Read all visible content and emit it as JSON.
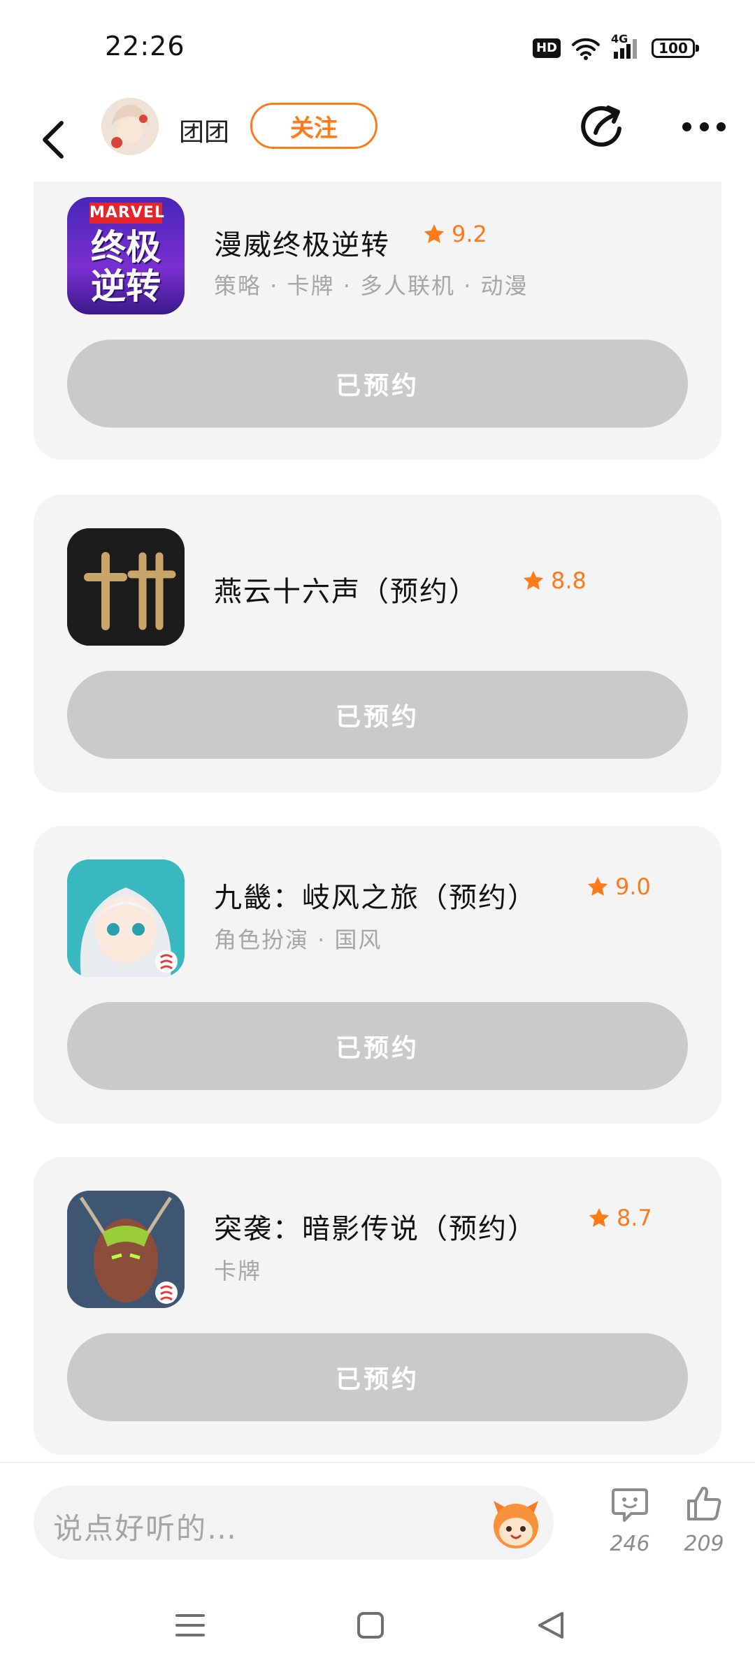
{
  "status_bar": {
    "time": "22:26",
    "hd": "HD",
    "network": "4G",
    "battery": "100"
  },
  "header": {
    "username": "团团",
    "follow_label": "关注"
  },
  "games": [
    {
      "title": "漫威终极逆转",
      "rating": "9.2",
      "tags": "策略 · 卡牌 · 多人联机 · 动漫",
      "button": "已预约",
      "icon": "marvel-snap-icon",
      "icon_text": "MARVEL",
      "icon_text2": "终极逆转"
    },
    {
      "title": "燕云十六声（预约）",
      "rating": "8.8",
      "tags": "",
      "button": "已预约",
      "icon": "yanyun-icon"
    },
    {
      "title": "九畿：岐风之旅（预约）",
      "rating": "9.0",
      "tags": "角色扮演 · 国风",
      "button": "已预约",
      "icon": "jiuji-icon"
    },
    {
      "title": "突袭：暗影传说（预约）",
      "rating": "8.7",
      "tags": "卡牌",
      "button": "已预约",
      "icon": "raid-icon"
    }
  ],
  "comment_bar": {
    "placeholder": "说点好听的…",
    "comments_count": "246",
    "likes_count": "209"
  },
  "colors": {
    "accent": "#ff7a1a",
    "button_gray": "#cacaca",
    "card_bg": "#f4f4f4"
  }
}
